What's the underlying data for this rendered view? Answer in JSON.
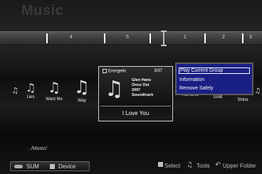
{
  "screen": {
    "title": "Music"
  },
  "group_bar": {
    "labels": [
      "4",
      "5",
      "1",
      "2",
      "3"
    ]
  },
  "items": [
    {
      "label": ""
    },
    {
      "label": "Lies"
    },
    {
      "label": "Want Me"
    },
    {
      "label": "Way"
    },
    {
      "label": "HaHaHa"
    },
    {
      "label": "Gold"
    },
    {
      "label": "Shine"
    }
  ],
  "selected": {
    "checkbox_label": "Energetic",
    "count": "3/37",
    "artist": "Glen Hans",
    "album": "Once Ost",
    "year": "2007",
    "genre": "Soundtrack",
    "title": "I Love You"
  },
  "menu": {
    "items": [
      "Play Current Group",
      "Information",
      "Remove Safely"
    ],
    "selected_index": 0
  },
  "path": "../Music/",
  "footer": {
    "sum_label": "SUM",
    "device_label": "Device",
    "select_label": "Select",
    "tools_label": "Tools",
    "upper_folder_label": "Upper Folder"
  },
  "colors": {
    "menu_bg": "#1a1f84",
    "background": "#000000",
    "highlight": "#ffffff"
  }
}
